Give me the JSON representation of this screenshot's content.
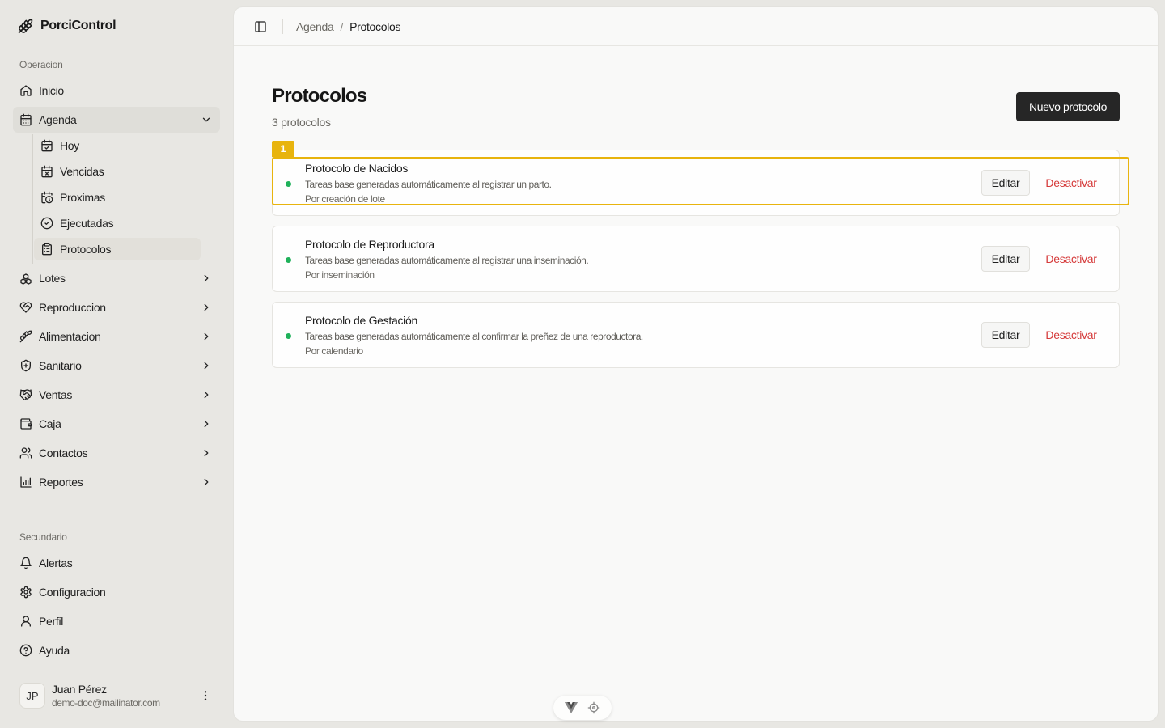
{
  "app": {
    "name": "PorciControl",
    "brand_icon": "wheat-icon"
  },
  "sidebar": {
    "section_operacion": "Operacion",
    "section_secundario": "Secundario",
    "items": [
      {
        "label": "Inicio",
        "icon": "home-icon"
      },
      {
        "label": "Agenda",
        "icon": "calendar-icon",
        "expanded": true
      },
      {
        "label": "Lotes",
        "icon": "boxes-icon"
      },
      {
        "label": "Reproduccion",
        "icon": "heart-handshake-icon"
      },
      {
        "label": "Alimentacion",
        "icon": "wheat-icon"
      },
      {
        "label": "Sanitario",
        "icon": "shield-plus-icon"
      },
      {
        "label": "Ventas",
        "icon": "handshake-icon"
      },
      {
        "label": "Caja",
        "icon": "wallet-icon"
      },
      {
        "label": "Contactos",
        "icon": "users-icon"
      },
      {
        "label": "Reportes",
        "icon": "bar-chart-icon"
      }
    ],
    "agenda_subitems": [
      {
        "label": "Hoy",
        "icon": "calendar-check-icon"
      },
      {
        "label": "Vencidas",
        "icon": "calendar-x-icon"
      },
      {
        "label": "Proximas",
        "icon": "calendar-clock-icon"
      },
      {
        "label": "Ejecutadas",
        "icon": "circle-check-icon"
      },
      {
        "label": "Protocolos",
        "icon": "clipboard-list-icon",
        "current": true
      }
    ],
    "secondary_items": [
      {
        "label": "Alertas",
        "icon": "bell-icon"
      },
      {
        "label": "Configuracion",
        "icon": "gear-icon"
      },
      {
        "label": "Perfil",
        "icon": "user-icon"
      },
      {
        "label": "Ayuda",
        "icon": "help-circle-icon"
      }
    ],
    "user": {
      "initials": "JP",
      "name": "Juan Pérez",
      "email": "demo-doc@mailinator.com"
    }
  },
  "header": {
    "breadcrumb": [
      "Agenda",
      "Protocolos"
    ],
    "separator": "/"
  },
  "page": {
    "title": "Protocolos",
    "subtitle": "3 protocolos",
    "primary_action": "Nuevo protocolo"
  },
  "protocols": [
    {
      "name": "Protocolo de Nacidos",
      "description": "Tareas base generadas automáticamente al registrar un parto.",
      "trigger": "Por creación de lote",
      "edit_label": "Editar",
      "deactivate_label": "Desactivar",
      "status_color": "#1fb15a"
    },
    {
      "name": "Protocolo de Reproductora",
      "description": "Tareas base generadas automáticamente al registrar una inseminación.",
      "trigger": "Por inseminación",
      "edit_label": "Editar",
      "deactivate_label": "Desactivar",
      "status_color": "#1fb15a"
    },
    {
      "name": "Protocolo de Gestación",
      "description": "Tareas base generadas automáticamente al confirmar la preñez de una reproductora.",
      "trigger": "Por calendario",
      "edit_label": "Editar",
      "deactivate_label": "Desactivar",
      "status_color": "#1fb15a"
    }
  ],
  "highlight": {
    "label": "1",
    "color": "#e8b40e"
  },
  "colors": {
    "accent_dark": "#262626",
    "danger": "#d53a3a",
    "status_active": "#1fb15a"
  }
}
